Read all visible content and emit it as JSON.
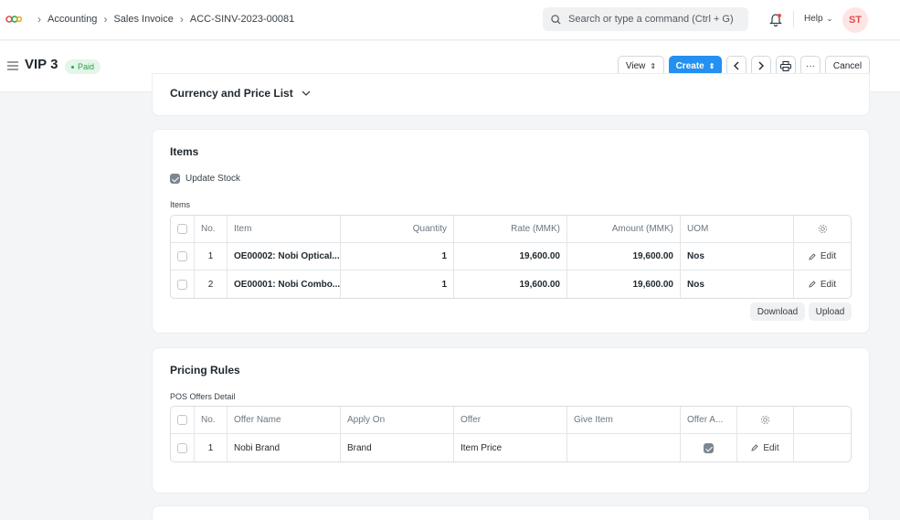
{
  "breadcrumbs": [
    "Accounting",
    "Sales Invoice",
    "ACC-SINV-2023-00081"
  ],
  "search": {
    "placeholder": "Search or type a command (Ctrl + G)"
  },
  "help_label": "Help",
  "avatar_initials": "ST",
  "page": {
    "title": "VIP 3",
    "status": "Paid",
    "buttons": {
      "view": "View",
      "create": "Create",
      "cancel": "Cancel",
      "more": "···"
    }
  },
  "currency_section": {
    "title": "Currency and Price List"
  },
  "items_section": {
    "title": "Items",
    "update_stock_label": "Update Stock",
    "table_label": "Items",
    "columns": [
      "No.",
      "Item",
      "Quantity",
      "Rate (MMK)",
      "Amount (MMK)",
      "UOM"
    ],
    "rows": [
      {
        "no": "1",
        "item": "OE00002: Nobi Optical...",
        "qty": "1",
        "rate": "19,600.00",
        "amount": "19,600.00",
        "uom": "Nos",
        "edit": "Edit"
      },
      {
        "no": "2",
        "item": "OE00001: Nobi Combo...",
        "qty": "1",
        "rate": "19,600.00",
        "amount": "19,600.00",
        "uom": "Nos",
        "edit": "Edit"
      }
    ],
    "download_label": "Download",
    "upload_label": "Upload"
  },
  "pricing_section": {
    "title": "Pricing Rules",
    "table_label": "POS Offers Detail",
    "columns": [
      "No.",
      "Offer Name",
      "Apply On",
      "Offer",
      "Give Item",
      "Offer A..."
    ],
    "rows": [
      {
        "no": "1",
        "offer_name": "Nobi Brand",
        "apply_on": "Brand",
        "offer": "Item Price",
        "give_item": "",
        "offer_applied": true,
        "edit": "Edit"
      }
    ]
  },
  "colors": {
    "primary": "#2490ef",
    "status_paid": "#28a745",
    "avatar_text": "#e24c4c"
  }
}
